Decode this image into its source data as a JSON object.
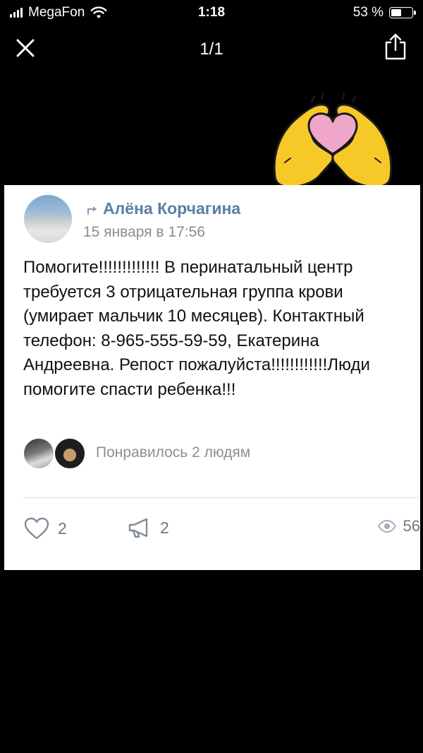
{
  "status_bar": {
    "carrier": "MegaFon",
    "time": "1:18",
    "battery": "53 %",
    "battery_level": 0.53
  },
  "viewer": {
    "counter": "1/1"
  },
  "post": {
    "author": "Алёна Корчагина",
    "date": "15 января в 17:56",
    "text": "Помогите!!!!!!!!!!!!! В перинатальный центр требуется 3 отрицательная группа крови (умирает мальчик 10 месяцев). Контактный телефон: 8-965-555-59-59, Екатерина Андреевна. Репост пожалуйста!!!!!!!!!!!!Люди помогите спасти ребенка!!!",
    "likes_text": "Понравилось 2 людям",
    "like_count": "2",
    "share_count": "2",
    "views_count": "56"
  },
  "colors": {
    "author_link": "#5a7fa6",
    "heart_pink": "#f0a6c8",
    "hands_yellow": "#f7c928",
    "icon_gray": "#6d7885"
  }
}
